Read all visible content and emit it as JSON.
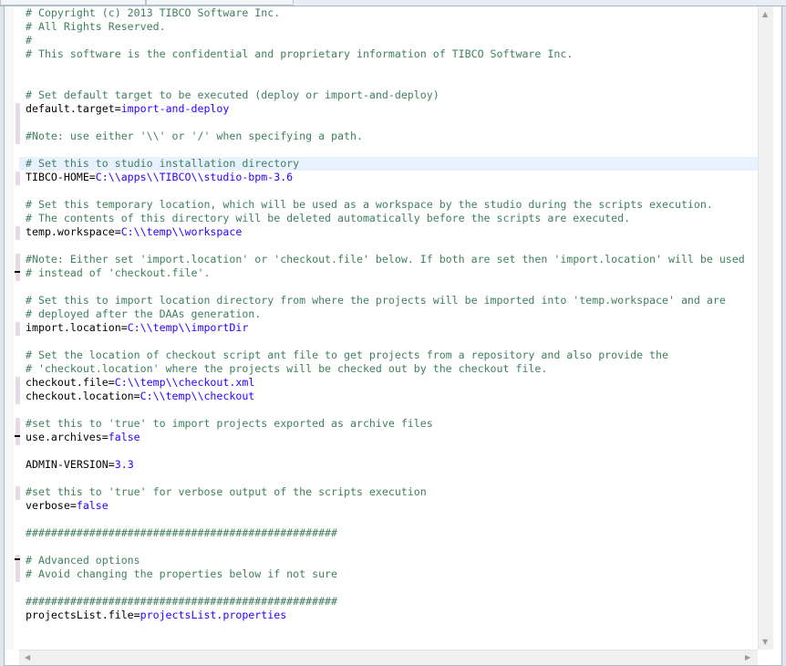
{
  "editor": {
    "highlighted_line": 11,
    "marked_lines": [
      7,
      8,
      9,
      12,
      16,
      18,
      19,
      23,
      27,
      28,
      30,
      31,
      35,
      40,
      41
    ],
    "lines": [
      {
        "type": "comment",
        "text": "# Copyright (c) 2013 TIBCO Software Inc."
      },
      {
        "type": "comment",
        "text": "# All Rights Reserved."
      },
      {
        "type": "comment",
        "text": "#"
      },
      {
        "type": "comment",
        "text": "# This software is the confidential and proprietary information of TIBCO Software Inc."
      },
      {
        "type": "blank",
        "text": ""
      },
      {
        "type": "blank",
        "text": ""
      },
      {
        "type": "comment",
        "text": "# Set default target to be executed (deploy or import-and-deploy)"
      },
      {
        "type": "property",
        "key": "default.target=",
        "value": "import-and-deploy"
      },
      {
        "type": "blank",
        "text": ""
      },
      {
        "type": "comment",
        "text": "#Note: use either '\\\\' or '/' when specifying a path."
      },
      {
        "type": "blank",
        "text": ""
      },
      {
        "type": "comment",
        "text": "# Set this to studio installation directory"
      },
      {
        "type": "property",
        "key": "TIBCO-HOME=",
        "value": "C:\\\\apps\\\\TIBCO\\\\studio-bpm-3.6"
      },
      {
        "type": "blank",
        "text": ""
      },
      {
        "type": "comment",
        "text": "# Set this temporary location, which will be used as a workspace by the studio during the scripts execution."
      },
      {
        "type": "comment",
        "text": "# The contents of this directory will be deleted automatically before the scripts are executed."
      },
      {
        "type": "property",
        "key": "temp.workspace=",
        "value": "C:\\\\temp\\\\workspace"
      },
      {
        "type": "blank",
        "text": ""
      },
      {
        "type": "comment",
        "text": "#Note: Either set 'import.location' or 'checkout.file' below. If both are set then 'import.location' will be used"
      },
      {
        "type": "comment",
        "text": "# instead of 'checkout.file'."
      },
      {
        "type": "blank",
        "text": ""
      },
      {
        "type": "comment",
        "text": "# Set this to import location directory from where the projects will be imported into 'temp.workspace' and are"
      },
      {
        "type": "comment",
        "text": "# deployed after the DAAs generation."
      },
      {
        "type": "property",
        "key": "import.location=",
        "value": "C:\\\\temp\\\\importDir"
      },
      {
        "type": "blank",
        "text": ""
      },
      {
        "type": "comment",
        "text": "# Set the location of checkout script ant file to get projects from a repository and also provide the"
      },
      {
        "type": "comment",
        "text": "# 'checkout.location' where the projects will be checked out by the checkout file."
      },
      {
        "type": "property",
        "key": "checkout.file=",
        "value": "C:\\\\temp\\\\checkout.xml"
      },
      {
        "type": "property",
        "key": "checkout.location=",
        "value": "C:\\\\temp\\\\checkout"
      },
      {
        "type": "blank",
        "text": ""
      },
      {
        "type": "comment",
        "text": "#set this to 'true' to import projects exported as archive files"
      },
      {
        "type": "property",
        "key": "use.archives=",
        "value": "false"
      },
      {
        "type": "blank",
        "text": ""
      },
      {
        "type": "property",
        "key": "ADMIN-VERSION=",
        "value": "3.3"
      },
      {
        "type": "blank",
        "text": ""
      },
      {
        "type": "comment",
        "text": "#set this to 'true' for verbose output of the scripts execution"
      },
      {
        "type": "property",
        "key": "verbose=",
        "value": "false"
      },
      {
        "type": "blank",
        "text": ""
      },
      {
        "type": "comment",
        "text": "#################################################"
      },
      {
        "type": "blank",
        "text": ""
      },
      {
        "type": "comment",
        "text": "# Advanced options"
      },
      {
        "type": "comment",
        "text": "# Avoid changing the properties below if not sure"
      },
      {
        "type": "blank",
        "text": ""
      },
      {
        "type": "comment",
        "text": "#################################################"
      },
      {
        "type": "property",
        "key": "projectsList.file=",
        "value": "projectsList.properties"
      }
    ]
  },
  "scrollbars": {
    "up": "▲",
    "down": "▼",
    "left": "◀",
    "right": "▶"
  },
  "colors": {
    "comment": "#3f7f5f",
    "key": "#000000",
    "value": "#2a00ff",
    "highlight": "#e8f2fe"
  }
}
